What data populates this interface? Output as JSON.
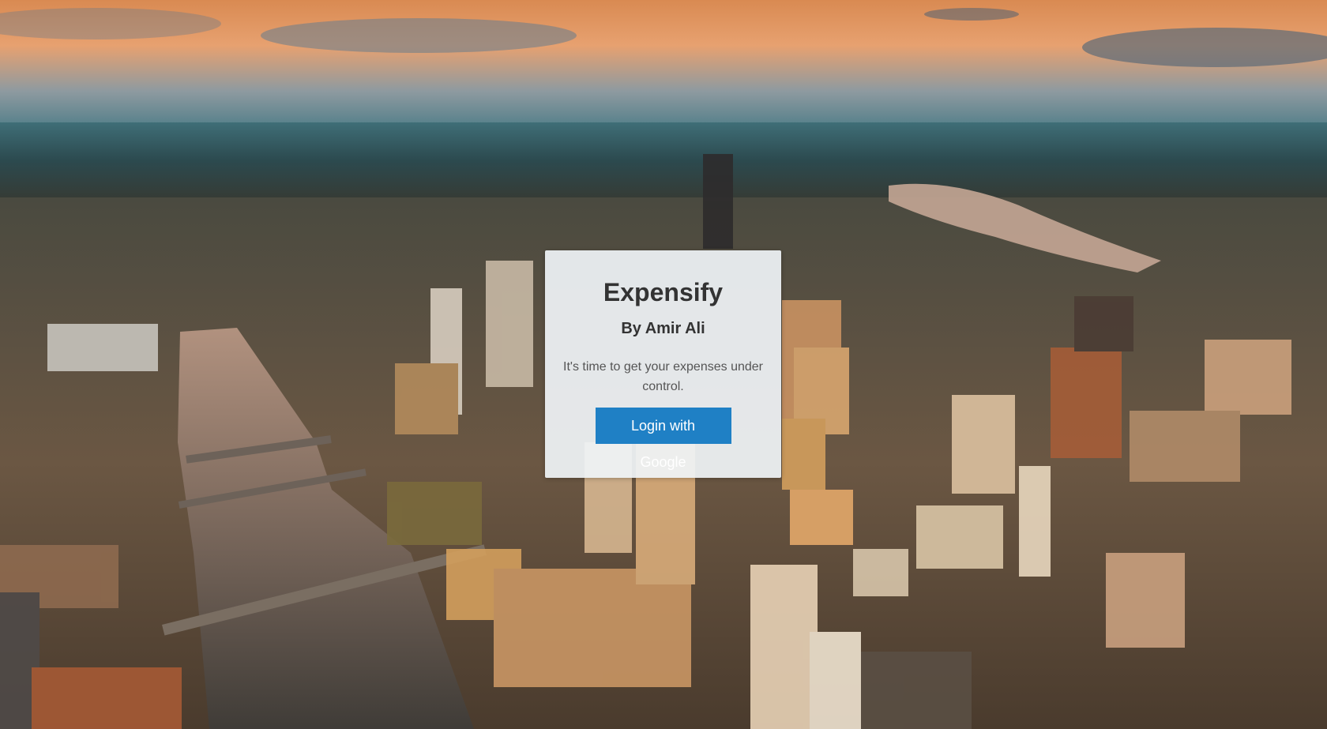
{
  "login": {
    "title": "Expensify",
    "author": "By Amir Ali",
    "tagline": "It's time to get your expenses under control.",
    "button_label": "Login with Google"
  },
  "background": {
    "scene": "aerial-city-sunset-photo"
  },
  "colors": {
    "button": "#1f80c5",
    "card": "#f0f4f7",
    "title_text": "#333333"
  }
}
